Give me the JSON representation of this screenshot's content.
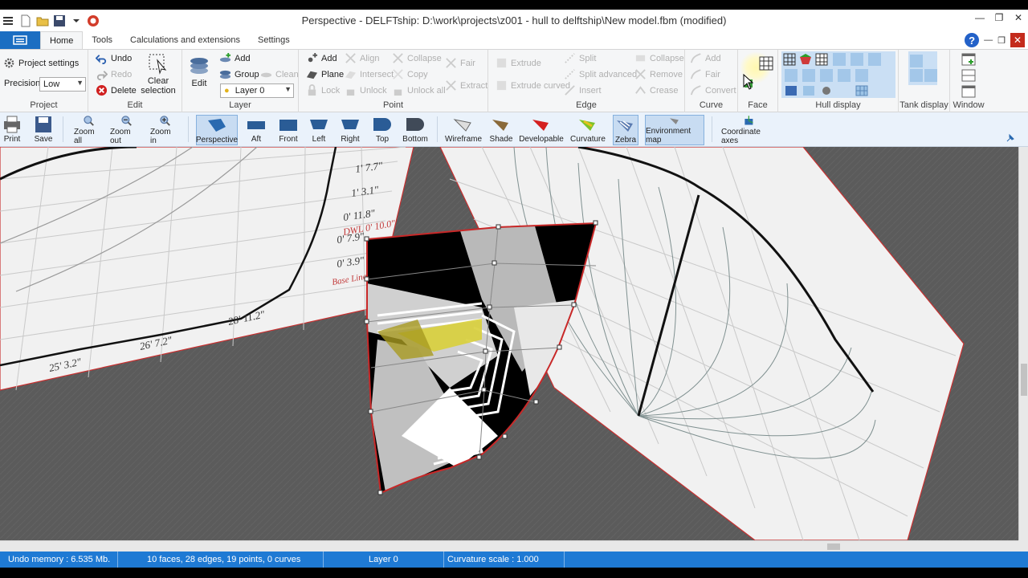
{
  "window": {
    "title": "Perspective - DELFTship: D:\\work\\projects\\z001 - hull to delftship\\New model.fbm (modified)"
  },
  "tabs": [
    "Home",
    "Tools",
    "Calculations and extensions",
    "Settings"
  ],
  "ribbon": {
    "project": {
      "label": "Project",
      "settings": "Project settings",
      "precision_label": "Precision",
      "precision_value": "Low"
    },
    "edit": {
      "label": "Edit",
      "undo": "Undo",
      "redo": "Redo",
      "delete": "Delete",
      "clear_selection_1": "Clear",
      "clear_selection_2": "selection"
    },
    "layer": {
      "label": "Layer",
      "edit": "Edit",
      "add": "Add",
      "group": "Group",
      "clean": "Clean",
      "current": "Layer 0"
    },
    "point": {
      "label": "Point",
      "add": "Add",
      "plane": "Plane",
      "lock": "Lock",
      "align": "Align",
      "intersect": "Intersect",
      "unlock": "Unlock",
      "collapse": "Collapse",
      "copy": "Copy",
      "unlock_all": "Unlock all",
      "fair": "Fair",
      "extract": "Extract"
    },
    "edge": {
      "label": "Edge",
      "extrude": "Extrude",
      "extrude_curved": "Extrude curved",
      "split": "Split",
      "split_advanced": "Split advanced",
      "insert": "Insert",
      "collapse": "Collapse",
      "remove": "Remove",
      "crease": "Crease"
    },
    "curve": {
      "label": "Curve",
      "add": "Add",
      "fair": "Fair",
      "convert": "Convert"
    },
    "face": {
      "label": "Face"
    },
    "hull_display": {
      "label": "Hull display"
    },
    "tank_display": {
      "label": "Tank display"
    },
    "window_group": {
      "label": "Window"
    }
  },
  "toolbar": {
    "print": "Print",
    "save": "Save",
    "zoom_all": "Zoom all",
    "zoom_out": "Zoom out",
    "zoom_in": "Zoom in",
    "perspective": "Perspective",
    "aft": "Aft",
    "front": "Front",
    "left": "Left",
    "right": "Right",
    "top": "Top",
    "bottom": "Bottom",
    "wireframe": "Wireframe",
    "shade": "Shade",
    "developable": "Developable",
    "curvature": "Curvature",
    "zebra": "Zebra",
    "environment_map": "Environment map",
    "coordinate_axes": "Coordinate axes"
  },
  "viewport": {
    "background_image_labels": [
      "25' 3.2\"",
      "26' 7.2\"",
      "28' 11.2\"",
      "1' 7.7\"",
      "1' 3.1\"",
      "0' 11.8\"",
      "0' 7.9\"",
      "0' 3.9\"",
      "DWL 0' 10.0\"",
      "Base Line"
    ]
  },
  "status": {
    "undo_memory": "Undo memory : 6.535 Mb.",
    "counts": "10 faces, 28 edges, 19 points, 0 curves",
    "layer": "Layer 0",
    "curvature_scale": "Curvature scale : 1.000"
  },
  "colors": {
    "statusbar": "#1f7ad4",
    "app_button": "#1b6ec2",
    "ribbon_bg": "#f5f6f7",
    "viewport_bg": "#5a5a5a",
    "hull_edge": "#c8282a"
  }
}
